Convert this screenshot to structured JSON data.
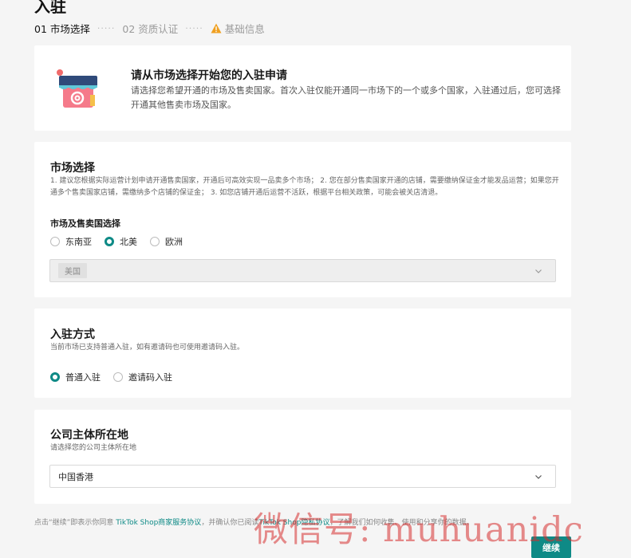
{
  "page_title": "入驻",
  "steps": [
    {
      "label": "01 市场选择"
    },
    {
      "label": "02 资质认证"
    },
    {
      "label": "基础信息"
    }
  ],
  "step_separator": "·····",
  "intro": {
    "title": "请从市场选择开始您的入驻申请",
    "description": "请选择您希望开通的市场及售卖国家。首次入驻仅能开通同一市场下的一个或多个国家，入驻通过后，您可选择开通其他售卖市场及国家。"
  },
  "market": {
    "title": "市场选择",
    "description": "1. 建议您根据实际运营计划申请开通售卖国家，开通后可高效实现一品卖多个市场； 2. 您在部分售卖国家开通的店铺，需要缴纳保证金才能发品运营；如果您开通多个售卖国家店铺，需缴纳多个店铺的保证金； 3. 如您店铺开通后运营不活跃，根据平台相关政策，可能会被关店清退。",
    "subtitle": "市场及售卖国选择",
    "options": [
      {
        "label": "东南亚",
        "checked": false
      },
      {
        "label": "北美",
        "checked": true
      },
      {
        "label": "欧洲",
        "checked": false
      }
    ],
    "selected_country": "美国"
  },
  "method": {
    "title": "入驻方式",
    "description": "当前市场已支持普通入驻，如有邀请码也可使用邀请码入驻。",
    "options": [
      {
        "label": "普通入驻",
        "checked": true
      },
      {
        "label": "邀请码入驻",
        "checked": false
      }
    ]
  },
  "company": {
    "title": "公司主体所在地",
    "description": "请选择您的公司主体所在地",
    "value": "中国香港"
  },
  "footer": {
    "prefix": "点击“继续”即表示你同意 ",
    "link1": "TikTok Shop商家服务协议",
    "middle": "，并确认你已阅读",
    "link2": "TikTok Shop隐私协议",
    "suffix": "，了解我们如何收集、使用和分享你的数据。"
  },
  "continue_label": "继续",
  "watermark": "微信号: muhuanidc",
  "colors": {
    "accent": "#0e8a86",
    "warning": "#f0a020",
    "background": "#f5f5f5"
  }
}
